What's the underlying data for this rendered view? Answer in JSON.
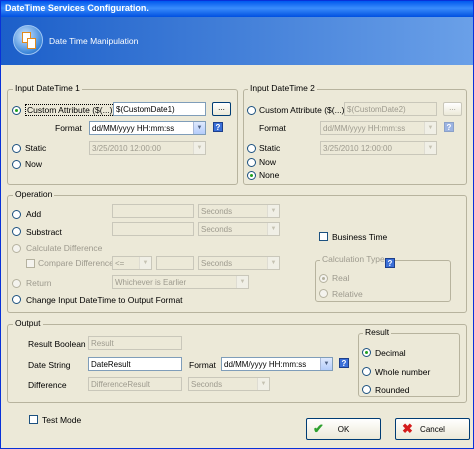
{
  "window": {
    "title": "DateTime Services Configuration."
  },
  "header": {
    "title": "Date Time Manipulation"
  },
  "input1": {
    "legend": "Input DateTime 1",
    "custom_label": "Custom Attribute ($(...))",
    "custom_value": "$(CustomDate1)",
    "browse_label": "...",
    "format_label": "Format",
    "format_value": "dd/MM/yyyy HH:mm:ss",
    "static_label": "Static",
    "static_value": "3/25/2010 12:00:00",
    "now_label": "Now",
    "help_label": "?"
  },
  "input2": {
    "legend": "Input DateTime 2",
    "custom_label": "Custom Attribute ($(...))",
    "custom_value": "$(CustomDate2)",
    "browse_label": "...",
    "format_label": "Format",
    "format_value": "dd/MM/yyyy HH:mm:ss",
    "static_label": "Static",
    "static_value": "3/25/2010 12:00:00",
    "now_label": "Now",
    "none_label": "None",
    "help_label": "?"
  },
  "operation": {
    "legend": "Operation",
    "add_label": "Add",
    "add_unit": "Seconds",
    "subtract_label": "Substract",
    "subtract_unit": "Seconds",
    "business_time_label": "Business Time",
    "calc_diff_label": "Calculate Difference",
    "compare_diff_label": "Compare Difference",
    "compare_op": "<=",
    "compare_unit": "Seconds",
    "return_label": "Return",
    "return_value": "Whichever is Earlier",
    "change_label": "Change Input DateTime to Output Format",
    "calc_type_legend": "Calculation Type",
    "calc_type_help": "?",
    "real_label": "Real",
    "relative_label": "Relative"
  },
  "output": {
    "legend": "Output",
    "result_boolean_label": "Result Boolean",
    "result_boolean_value": "Result",
    "date_string_label": "Date String",
    "date_string_value": "DateResult",
    "format_label": "Format",
    "format_value": "dd/MM/yyyy HH:mm:ss",
    "help_label": "?",
    "difference_label": "Difference",
    "difference_value": "DifferenceResult",
    "difference_unit": "Seconds",
    "result_legend": "Result",
    "decimal_label": "Decimal",
    "whole_label": "Whole number",
    "rounded_label": "Rounded"
  },
  "footer": {
    "test_mode_label": "Test Mode",
    "ok_label": "OK",
    "cancel_label": "Cancel"
  }
}
